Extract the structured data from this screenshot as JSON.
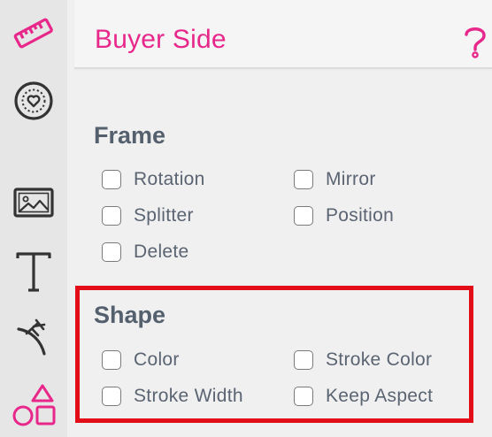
{
  "header": {
    "title": "Buyer Side"
  },
  "sidebar": {
    "icons": [
      "ruler-icon",
      "heart-badge-icon",
      "image-icon",
      "text-icon",
      "curve-tool-icon",
      "shapes-icon"
    ]
  },
  "sections": {
    "frame": {
      "title": "Frame",
      "options": [
        "Rotation",
        "Mirror",
        "Splitter",
        "Position",
        "Delete"
      ]
    },
    "shape": {
      "title": "Shape",
      "options": [
        "Color",
        "Stroke Color",
        "Stroke Width",
        "Keep Aspect"
      ]
    }
  },
  "colors": {
    "accent": "#e8278a",
    "highlight": "#e30d17",
    "section_title": "#55606e",
    "label": "#5b6472"
  }
}
